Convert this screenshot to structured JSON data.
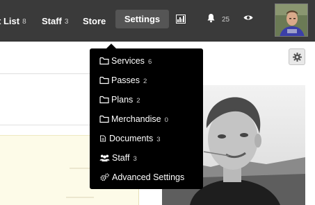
{
  "nav": {
    "items": [
      {
        "label": "t List",
        "count": "8"
      },
      {
        "label": "Staff",
        "count": "3"
      },
      {
        "label": "Store",
        "count": ""
      }
    ],
    "settings_label": "Settings",
    "notifications_count": "25",
    "icons": [
      "bar-chart-icon",
      "bell-icon",
      "eye-icon"
    ]
  },
  "settings_menu": {
    "items": [
      {
        "label": "Services",
        "count": "6",
        "icon": "folder-icon"
      },
      {
        "label": "Passes",
        "count": "2",
        "icon": "folder-icon"
      },
      {
        "label": "Plans",
        "count": "2",
        "icon": "folder-icon"
      },
      {
        "label": "Merchandise",
        "count": "0",
        "icon": "folder-icon"
      },
      {
        "label": "Documents",
        "count": "3",
        "icon": "document-icon"
      },
      {
        "label": "Staff",
        "count": "3",
        "icon": "users-icon"
      },
      {
        "label": "Advanced Settings",
        "count": "",
        "icon": "gears-icon"
      }
    ]
  },
  "colors": {
    "topbar": "#3a3a3a",
    "active_tab": "#555555",
    "dropdown": "#000000",
    "highlight_panel": "#fdfbe8"
  }
}
